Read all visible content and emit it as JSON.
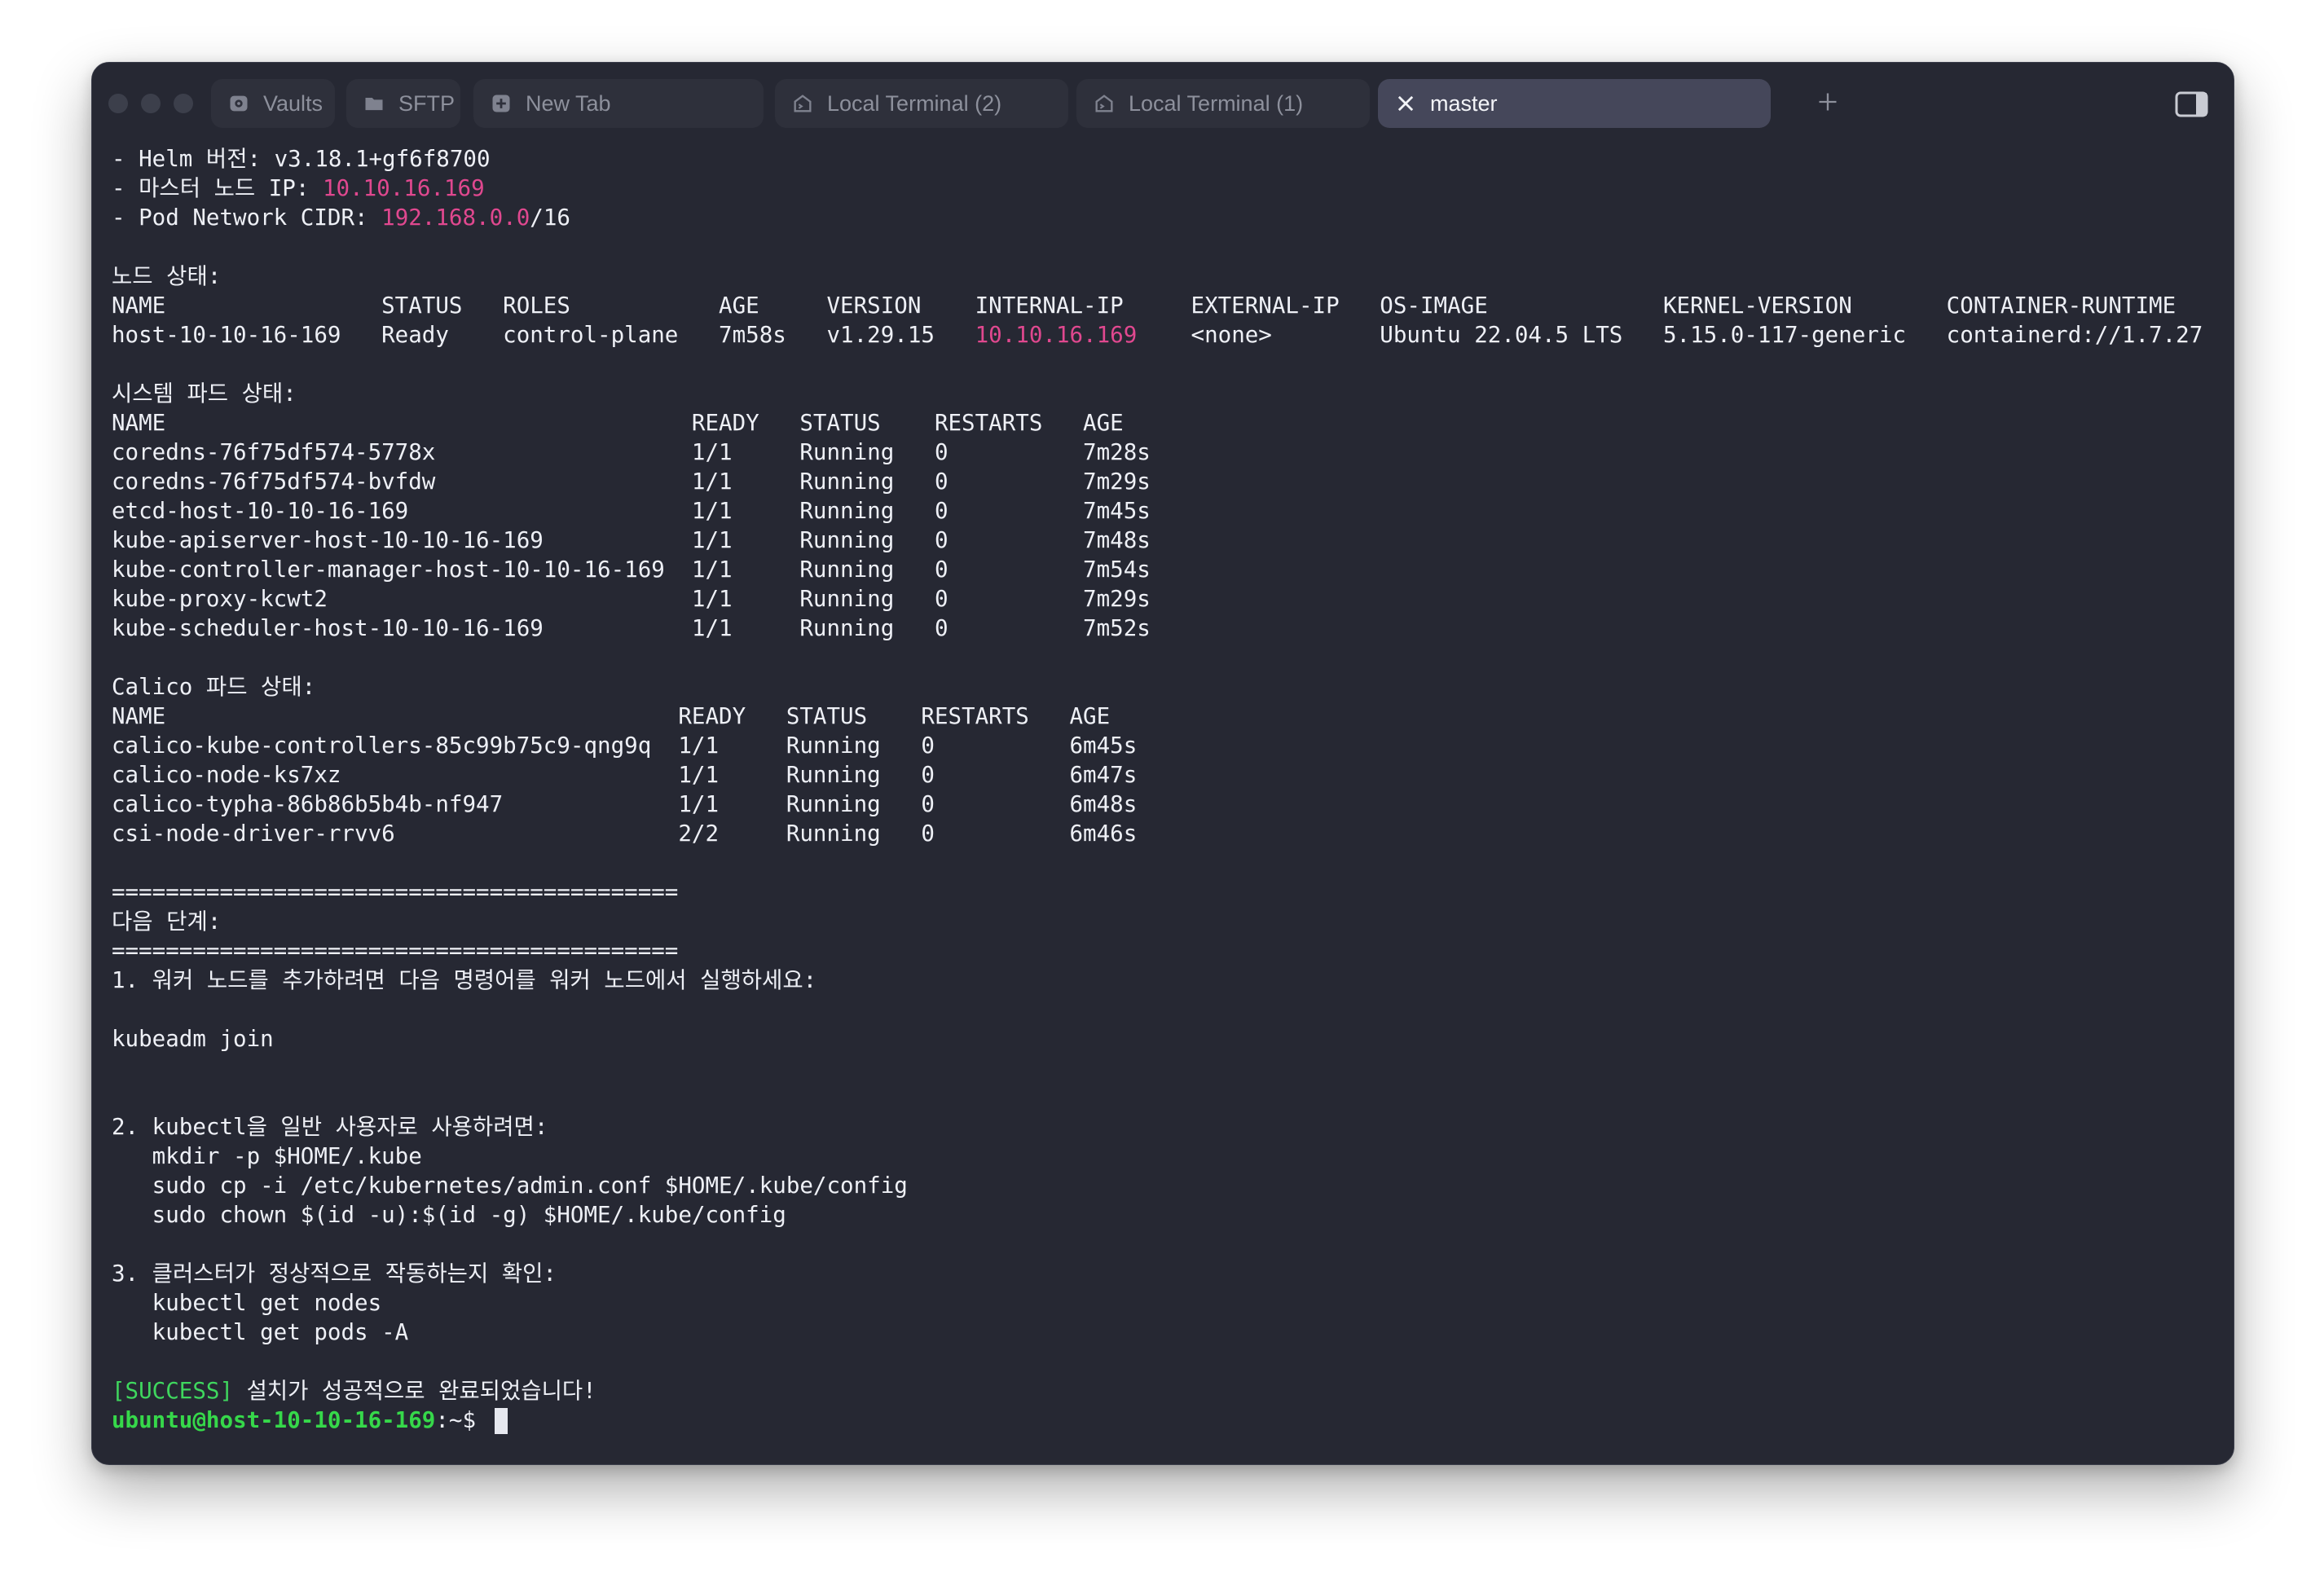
{
  "tabs": [
    {
      "label": "Vaults",
      "icon": "vault-icon"
    },
    {
      "label": "SFTP",
      "icon": "folder-icon"
    },
    {
      "label": "New Tab",
      "icon": "plus-square-icon"
    },
    {
      "label": "Local Terminal (2)",
      "icon": "terminal-icon"
    },
    {
      "label": "Local Terminal (1)",
      "icon": "terminal-icon"
    },
    {
      "label": "master",
      "icon": "close-icon"
    }
  ],
  "terminal": {
    "lines": [
      [
        {
          "t": "- Helm 버전: v3.18.1+gf6f8700"
        }
      ],
      [
        {
          "t": "- 마스터 노드 IP: "
        },
        {
          "t": "10.10.16.169",
          "c": "hl"
        }
      ],
      [
        {
          "t": "- Pod Network CIDR: "
        },
        {
          "t": "192.168.0.0",
          "c": "hl"
        },
        {
          "t": "/16"
        }
      ],
      [
        {
          "t": ""
        }
      ],
      [
        {
          "t": "노드 상태:"
        }
      ],
      [
        {
          "t": "NAME                STATUS   ROLES           AGE     VERSION    INTERNAL-IP     EXTERNAL-IP   OS-IMAGE             KERNEL-VERSION       CONTAINER-RUNTIME"
        }
      ],
      [
        {
          "t": "host-10-10-16-169   Ready    control-plane   7m58s   v1.29.15   "
        },
        {
          "t": "10.10.16.169",
          "c": "hl"
        },
        {
          "t": "    <none>        Ubuntu 22.04.5 LTS   5.15.0-117-generic   containerd://1.7.27"
        }
      ],
      [
        {
          "t": ""
        }
      ],
      [
        {
          "t": "시스템 파드 상태:"
        }
      ],
      [
        {
          "t": "NAME                                       READY   STATUS    RESTARTS   AGE"
        }
      ],
      [
        {
          "t": "coredns-76f75df574-5778x                   1/1     Running   0          7m28s"
        }
      ],
      [
        {
          "t": "coredns-76f75df574-bvfdw                   1/1     Running   0          7m29s"
        }
      ],
      [
        {
          "t": "etcd-host-10-10-16-169                     1/1     Running   0          7m45s"
        }
      ],
      [
        {
          "t": "kube-apiserver-host-10-10-16-169           1/1     Running   0          7m48s"
        }
      ],
      [
        {
          "t": "kube-controller-manager-host-10-10-16-169  1/1     Running   0          7m54s"
        }
      ],
      [
        {
          "t": "kube-proxy-kcwt2                           1/1     Running   0          7m29s"
        }
      ],
      [
        {
          "t": "kube-scheduler-host-10-10-16-169           1/1     Running   0          7m52s"
        }
      ],
      [
        {
          "t": ""
        }
      ],
      [
        {
          "t": "Calico 파드 상태:"
        }
      ],
      [
        {
          "t": "NAME                                      READY   STATUS    RESTARTS   AGE"
        }
      ],
      [
        {
          "t": "calico-kube-controllers-85c99b75c9-qng9q  1/1     Running   0          6m45s"
        }
      ],
      [
        {
          "t": "calico-node-ks7xz                         1/1     Running   0          6m47s"
        }
      ],
      [
        {
          "t": "calico-typha-86b86b5b4b-nf947             1/1     Running   0          6m48s"
        }
      ],
      [
        {
          "t": "csi-node-driver-rrvv6                     2/2     Running   0          6m46s"
        }
      ],
      [
        {
          "t": ""
        }
      ],
      [
        {
          "t": "=========================================="
        }
      ],
      [
        {
          "t": "다음 단계:"
        }
      ],
      [
        {
          "t": "=========================================="
        }
      ],
      [
        {
          "t": "1. 워커 노드를 추가하려면 다음 명령어를 워커 노드에서 실행하세요:"
        }
      ],
      [
        {
          "t": ""
        }
      ],
      [
        {
          "t": "kubeadm join"
        }
      ],
      [
        {
          "t": ""
        }
      ],
      [
        {
          "t": ""
        }
      ],
      [
        {
          "t": "2. kubectl을 일반 사용자로 사용하려면:"
        }
      ],
      [
        {
          "t": "   mkdir -p $HOME/.kube"
        }
      ],
      [
        {
          "t": "   sudo cp -i /etc/kubernetes/admin.conf $HOME/.kube/config"
        }
      ],
      [
        {
          "t": "   sudo chown $(id -u):$(id -g) $HOME/.kube/config"
        }
      ],
      [
        {
          "t": ""
        }
      ],
      [
        {
          "t": "3. 클러스터가 정상적으로 작동하는지 확인:"
        }
      ],
      [
        {
          "t": "   kubectl get nodes"
        }
      ],
      [
        {
          "t": "   kubectl get pods -A"
        }
      ],
      [
        {
          "t": ""
        }
      ],
      [
        {
          "t": "[SUCCESS]",
          "c": "succ"
        },
        {
          "t": " 설치가 성공적으로 완료되었습니다!"
        }
      ]
    ],
    "prompt": {
      "user_host": "ubuntu@host-10-10-16-169",
      "path": ":~$ "
    }
  },
  "colors": {
    "background": "#262833",
    "text": "#eef0f6",
    "highlight": "#e0488f",
    "success": "#3fd75e",
    "prompt": "#36d84a",
    "active_tab": "#45475a"
  }
}
